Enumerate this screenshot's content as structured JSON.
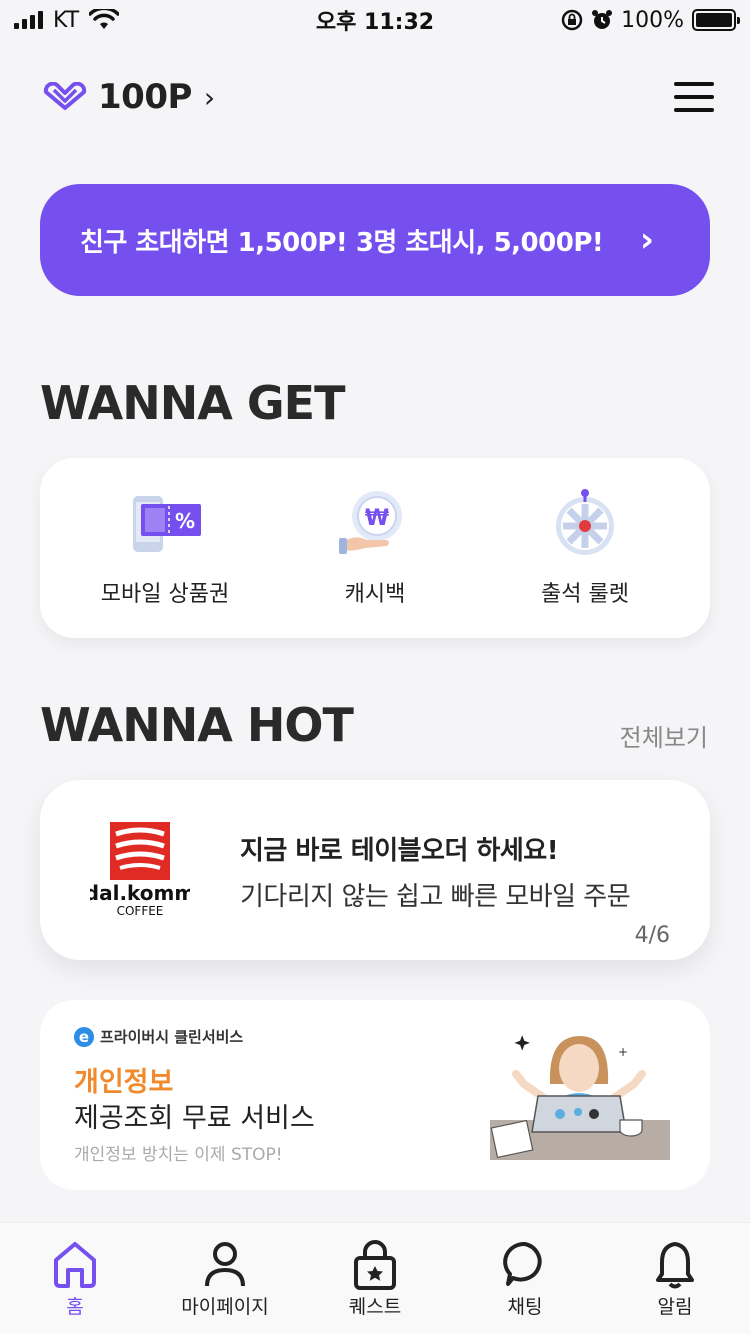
{
  "status_bar": {
    "carrier": "KT",
    "time": "오후 11:32",
    "battery": "100%"
  },
  "header": {
    "points": "100P"
  },
  "invite_banner": {
    "text": "친구 초대하면 1,500P! 3명 초대시, 5,000P!"
  },
  "wanna_get": {
    "title": "WANNA GET",
    "items": [
      {
        "label": "모바일 상품권",
        "icon": "gift-voucher-icon"
      },
      {
        "label": "캐시백",
        "icon": "cashback-icon"
      },
      {
        "label": "출석 룰렛",
        "icon": "roulette-icon"
      }
    ]
  },
  "wanna_hot": {
    "title": "WANNA HOT",
    "see_all": "전체보기",
    "card": {
      "brand_name": "dal.komm",
      "brand_sub": "COFFEE",
      "title": "지금 바로 테이블오더 하세요!",
      "subtitle": "기다리지 않는 쉽고 빠른 모바일 주문",
      "page": "4/6"
    }
  },
  "privacy_banner": {
    "brand": "프라이버시 클린서비스",
    "title_highlight": "개인정보",
    "title": "제공조회 무료 서비스",
    "subtitle": "개인정보 방치는 이제 STOP!"
  },
  "bottom_nav": {
    "items": [
      {
        "label": "홈",
        "icon": "home-icon",
        "active": true
      },
      {
        "label": "마이페이지",
        "icon": "person-icon",
        "active": false
      },
      {
        "label": "퀘스트",
        "icon": "quest-icon",
        "active": false
      },
      {
        "label": "채팅",
        "icon": "chat-icon",
        "active": false
      },
      {
        "label": "알림",
        "icon": "bell-icon",
        "active": false
      }
    ]
  },
  "colors": {
    "accent": "#7650ef",
    "background": "#f5f5f7",
    "highlight_orange": "#f08a2c"
  }
}
